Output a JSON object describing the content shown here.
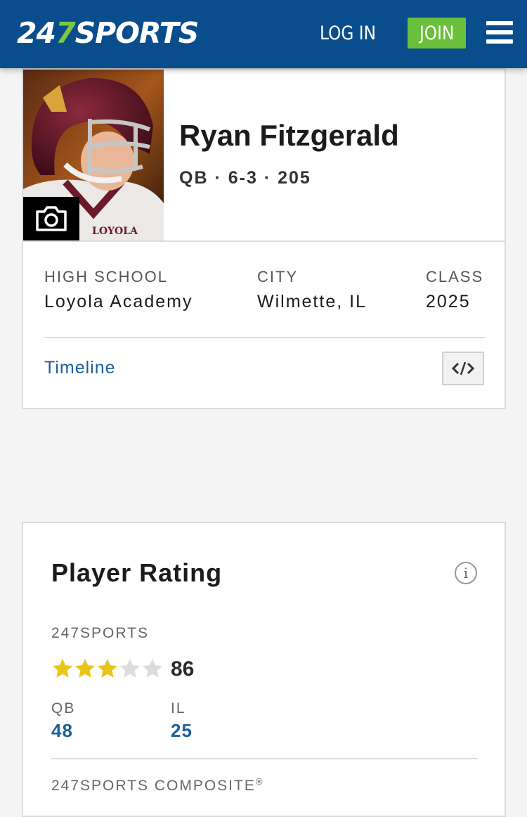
{
  "header": {
    "logo_num_a": "24",
    "logo_num_b": "7",
    "logo_text": "SPORTS",
    "login_label": "LOG IN",
    "join_label": "JOIN",
    "menu_icon": "hamburger-menu-icon",
    "colors": {
      "header_bg": "#0a4d8c",
      "join_bg": "#6abf3b",
      "logo_accent": "#7ac943"
    }
  },
  "player": {
    "name": "Ryan Fitzgerald",
    "meta": "QB · 6-3 · 205",
    "photo_icon": "camera-icon",
    "info": [
      {
        "label": "HIGH SCHOOL",
        "value": "Loyola Academy"
      },
      {
        "label": "CITY",
        "value": "Wilmette, IL"
      },
      {
        "label": "CLASS",
        "value": "2025"
      }
    ],
    "timeline_label": "Timeline",
    "embed_icon": "code-embed-icon"
  },
  "rating": {
    "title": "Player Rating",
    "info_icon": "info-icon",
    "source_label": "247SPORTS",
    "stars_filled": 3,
    "stars_total": 5,
    "score": "86",
    "ranks": [
      {
        "label": "QB",
        "value": "48"
      },
      {
        "label": "IL",
        "value": "25"
      }
    ],
    "composite_label": "247SPORTS COMPOSITE",
    "composite_mark": "®",
    "colors": {
      "star_filled": "#e8c619",
      "star_empty": "#dcdcdc",
      "link": "#1b5f99"
    }
  }
}
